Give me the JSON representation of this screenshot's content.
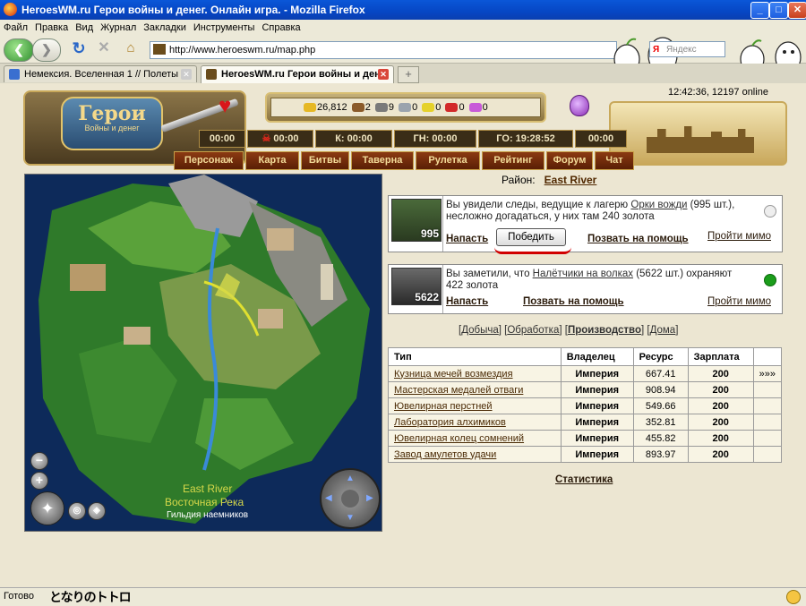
{
  "window": {
    "title": "HeroesWM.ru Герои войны и денег. Онлайн игра. - Mozilla Firefox",
    "min": "_",
    "max": "□",
    "close": "✕"
  },
  "menubar": [
    "Файл",
    "Правка",
    "Вид",
    "Журнал",
    "Закладки",
    "Инструменты",
    "Справка"
  ],
  "nav": {
    "url": "http://www.heroeswm.ru/map.php",
    "search_placeholder": "Яндекс",
    "search_logo": "Я"
  },
  "tabs": [
    {
      "label": "Немексия. Вселенная 1 // Полеты",
      "active": false
    },
    {
      "label": "HeroesWM.ru Герои войны и ден...",
      "active": true
    }
  ],
  "game": {
    "logo_title": "Герои",
    "logo_sub": "Войны и денег",
    "clock": "12:42:36, 12197 online",
    "resources": [
      "26,812",
      "2",
      "9",
      "0",
      "0",
      "0",
      "0"
    ],
    "timers": [
      "00:00",
      "00:00",
      "К: 00:00",
      "ГН: 00:00",
      "ГО: 19:28:52",
      "00:00"
    ],
    "timer_icon": "☠",
    "menu": [
      "Персонаж",
      "Карта",
      "Битвы",
      "Таверна",
      "Рулетка",
      "Рейтинг",
      "Форум",
      "Чат"
    ]
  },
  "map": {
    "label_en": "East River",
    "label_ru": "Восточная Река",
    "guild": "Гильдия наемников",
    "zoom_out": "−",
    "zoom_in": "+"
  },
  "district": {
    "label": "Район:",
    "name": "East River"
  },
  "encounters": [
    {
      "count": "995",
      "text_pre": "Вы увидели следы, ведущие к лагерю ",
      "link": "Орки вожди",
      "text_post": " (995 шт.), несложно догадаться, у них там 240 золота",
      "attack": "Напасть",
      "win": "Победить",
      "call": "Позвать на помощь",
      "pass": "Пройти мимо"
    },
    {
      "count": "5622",
      "text_pre": "Вы заметили, что ",
      "link": "Налётчики на волках",
      "text_post": " (5622 шт.) охраняют 422 золота",
      "attack": "Напасть",
      "call": "Позвать на помощь",
      "pass": "Пройти мимо"
    }
  ],
  "categories": [
    {
      "label": "Добыча",
      "current": false
    },
    {
      "label": "Обработка",
      "current": false
    },
    {
      "label": "Производство",
      "current": true
    },
    {
      "label": "Дома",
      "current": false
    }
  ],
  "table": {
    "headers": [
      "Тип",
      "Владелец",
      "Ресурс",
      "Зарплата",
      ""
    ],
    "rows": [
      {
        "name": "Кузница мечей возмездия",
        "owner": "Империя",
        "res": "667.41",
        "pay": "200",
        "extra": "»»»"
      },
      {
        "name": "Мастерская медалей отваги",
        "owner": "Империя",
        "res": "908.94",
        "pay": "200",
        "extra": ""
      },
      {
        "name": "Ювелирная перстней",
        "owner": "Империя",
        "res": "549.66",
        "pay": "200",
        "extra": ""
      },
      {
        "name": "Лаборатория алхимиков",
        "owner": "Империя",
        "res": "352.81",
        "pay": "200",
        "extra": ""
      },
      {
        "name": "Ювелирная колец сомнений",
        "owner": "Империя",
        "res": "455.82",
        "pay": "200",
        "extra": ""
      },
      {
        "name": "Завод амулетов удачи",
        "owner": "Империя",
        "res": "893.97",
        "pay": "200",
        "extra": ""
      }
    ]
  },
  "statistics": "Статистика",
  "status": {
    "text": "Готово",
    "deco": "となりのトトロ"
  },
  "colors": {
    "titlebar": "#0a57d8",
    "page_bg": "#ece6d2",
    "menu_btn": "#8b3a12",
    "online_dot": "#1b9d1b",
    "win_underline": "#d10000"
  }
}
